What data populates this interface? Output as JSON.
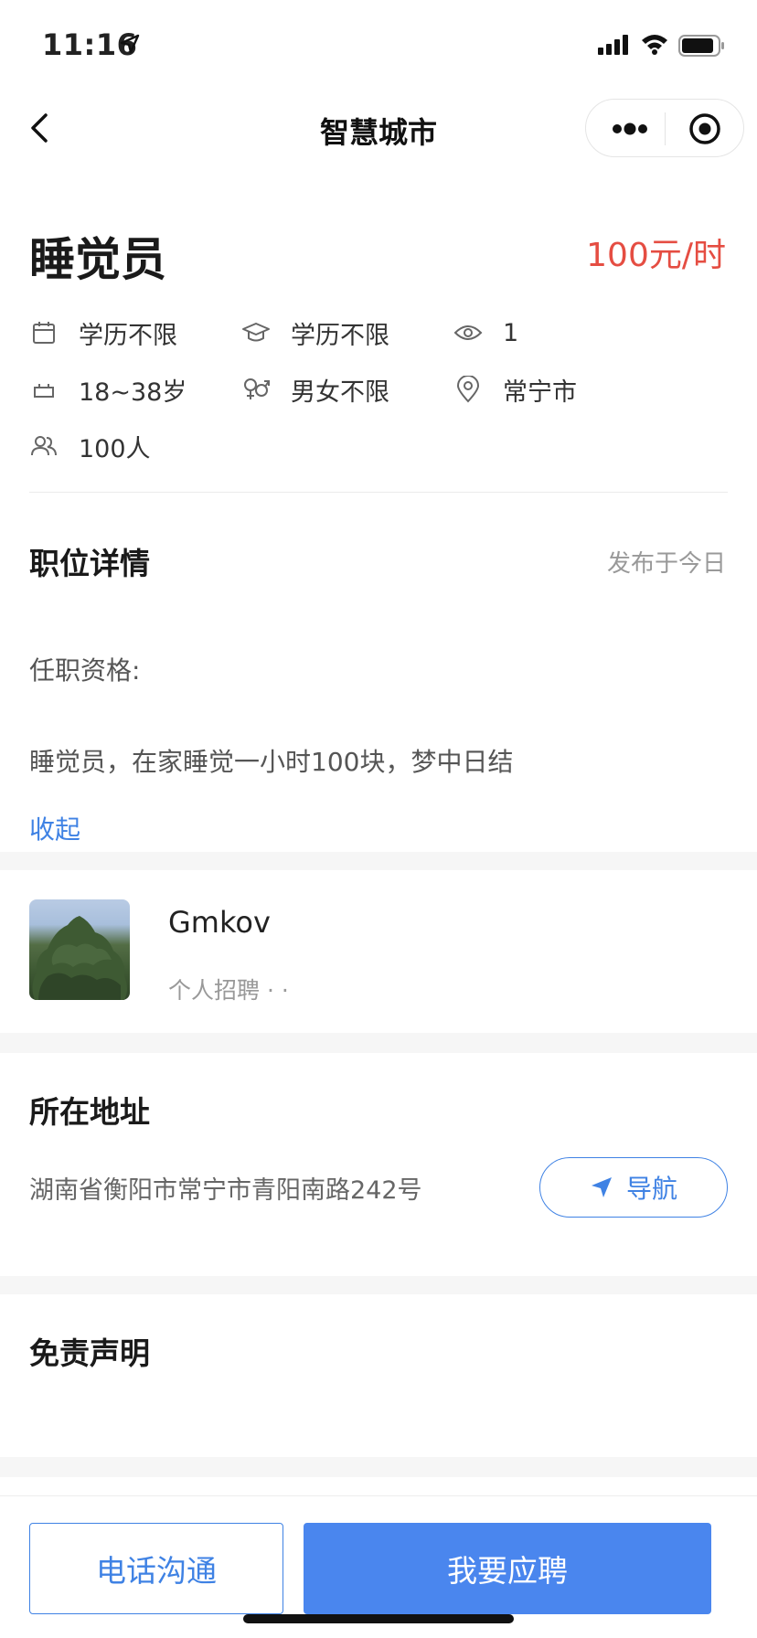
{
  "status_bar": {
    "time": "11:16"
  },
  "nav": {
    "title": "智慧城市"
  },
  "job": {
    "title": "睡觉员",
    "salary": "100元/时",
    "info": {
      "education_a": "学历不限",
      "education_b": "学历不限",
      "views": "1",
      "age": "18~38岁",
      "gender": "男女不限",
      "city": "常宁市",
      "headcount": "100人"
    }
  },
  "details": {
    "title": "职位详情",
    "published": "发布于今日",
    "qualification_label": "任职资格:",
    "qualification_text": "睡觉员，在家睡觉一小时100块，梦中日结",
    "collapse_label": "收起"
  },
  "recruiter": {
    "name": "Gmkov",
    "type": "个人招聘 · ·"
  },
  "address": {
    "title": "所在地址",
    "text": "湖南省衡阳市常宁市青阳南路242号",
    "navigate_label": "导航"
  },
  "disclaimer": {
    "title": "免责声明"
  },
  "actions": {
    "call_label": "电话沟通",
    "apply_label": "我要应聘"
  },
  "colors": {
    "accent": "#4a86ee",
    "salary": "#e54d42"
  }
}
